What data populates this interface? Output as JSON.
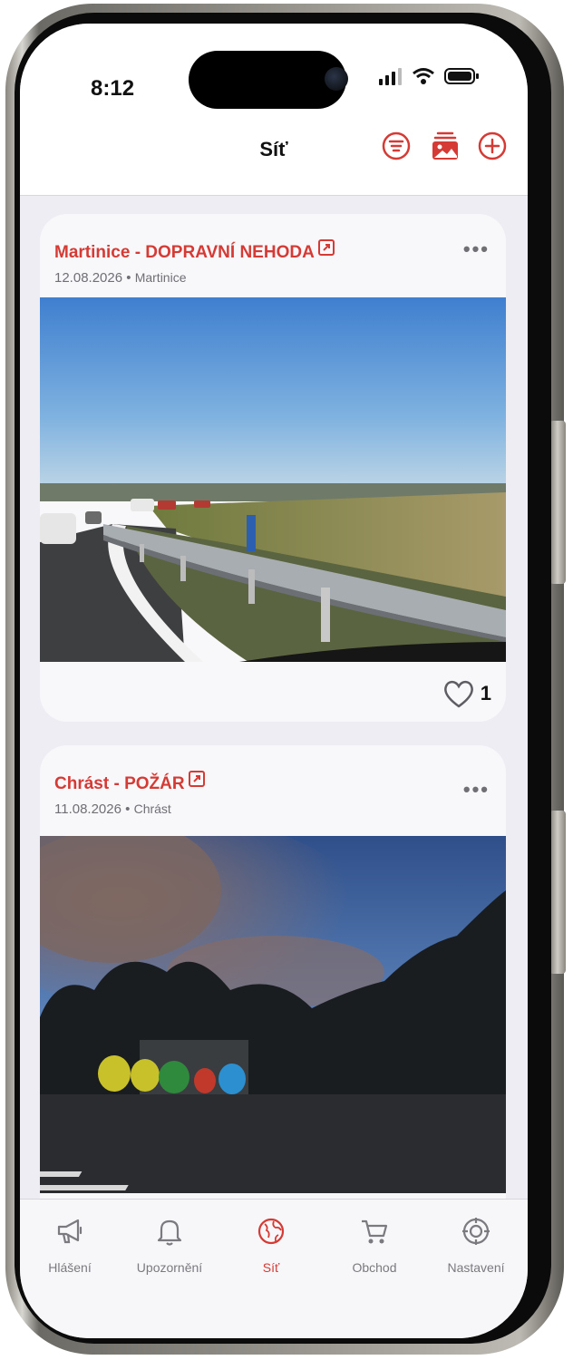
{
  "status": {
    "time": "8:12"
  },
  "header": {
    "title": "Síť"
  },
  "icons": {
    "filter": "filter-icon",
    "gallery": "gallery-icon",
    "add": "add-icon",
    "more": "more-icon",
    "external": "external-link-icon",
    "heart": "heart-icon"
  },
  "posts": [
    {
      "title": "Martinice - DOPRAVNÍ NEHODA",
      "date": "12.08.2026",
      "separator": "•",
      "location": "Martinice",
      "more": "•••",
      "likes": "1"
    },
    {
      "title": "Chrást - POŽÁR",
      "date": "11.08.2026",
      "separator": "•",
      "location": "Chrást",
      "more": "•••"
    }
  ],
  "tabs": [
    {
      "label": "Hlášení",
      "icon": "megaphone-icon"
    },
    {
      "label": "Upozornění",
      "icon": "bell-icon"
    },
    {
      "label": "Síť",
      "icon": "globe-icon",
      "active": true
    },
    {
      "label": "Obchod",
      "icon": "cart-icon"
    },
    {
      "label": "Nastavení",
      "icon": "settings-icon"
    }
  ],
  "colors": {
    "accent": "#d53a34",
    "background": "#eeedf3",
    "card": "#f8f8fb"
  }
}
